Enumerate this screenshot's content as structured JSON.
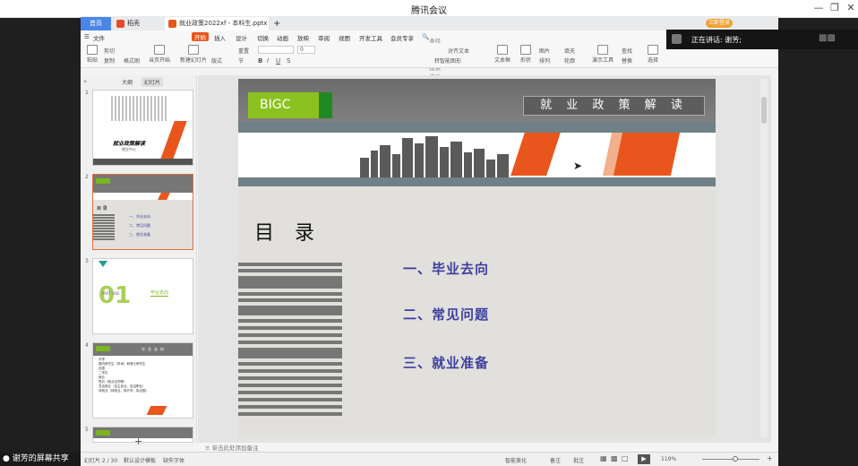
{
  "meeting": {
    "app_title": "腾讯会议"
  },
  "wps": {
    "tabs": {
      "home": "首页",
      "daoke": "稻壳",
      "doc": "就业政策2022xf - 本科生.pptx",
      "add": "+"
    },
    "login": "立即登录",
    "ribbon_tabs": [
      "文件",
      "开始",
      "插入",
      "设计",
      "切换",
      "动画",
      "放映",
      "审阅",
      "视图",
      "开发工具",
      "会员专享"
    ],
    "search_hint": "查找命令、搜索模板",
    "ribbon": {
      "paste": "粘贴",
      "cut": "剪切",
      "copy": "复制",
      "format_painter": "格式刷",
      "from_current": "当页开始",
      "new_slide": "新建幻灯片",
      "layout": "版式",
      "reset": "重置",
      "section": "节",
      "font_size": "0",
      "textbox": "文本框",
      "shapes": "形状",
      "picture": "图片",
      "arrange": "排列",
      "outline": "轮廓",
      "fill": "填充",
      "presenter": "演示工具",
      "find": "查找",
      "replace": "替换",
      "select": "选择",
      "align_text": "对齐文本",
      "smartart": "转智能图形"
    },
    "pane_tabs": {
      "outline": "大纲",
      "slides": "幻灯片"
    },
    "thumbs": [
      {
        "num": "1",
        "title": "就业政策解读",
        "sub": "就业中心"
      },
      {
        "num": "2",
        "heading": "目 录",
        "items": [
          "一、毕业去向",
          "二、常见问题",
          "三、就业准备"
        ]
      },
      {
        "num": "3",
        "part": "PART ONE",
        "big": "01",
        "label": "毕业去向"
      },
      {
        "num": "4",
        "heading": "毕业去向",
        "lines": [
          "升学",
          "国内研究生（学术）和博士研究生",
          "出国",
          "二学位",
          "就业",
          "签约（就业合同等）",
          "灵活就业（自主创业、自由职业）",
          "待就业（待就业、拟升学、拟出国）"
        ]
      },
      {
        "num": "5"
      }
    ],
    "slide": {
      "logo": "BIGC",
      "banner": "就 业 政 策 解 读",
      "toc_title": "目 录",
      "items": [
        "一、毕业去向",
        "二、常见问题",
        "三、就业准备"
      ]
    },
    "notes_hint": "单击此处添加备注",
    "status": {
      "slide_count": "幻灯片 2 / 30",
      "template": "默认设计模板",
      "missing_font": "缺失字体",
      "smart_beautify": "智能美化",
      "notes": "备注",
      "comments": "批注",
      "zoom": "119%"
    }
  },
  "speaker": {
    "text": "正在讲话: 谢芳;"
  },
  "share": {
    "label": "谢芳的屏幕共享"
  },
  "colors": {
    "accent_orange": "#e8561d",
    "brand_green": "#7ab51d",
    "menu_blue": "#3d3ea0",
    "tab_blue": "#4a86e8"
  }
}
